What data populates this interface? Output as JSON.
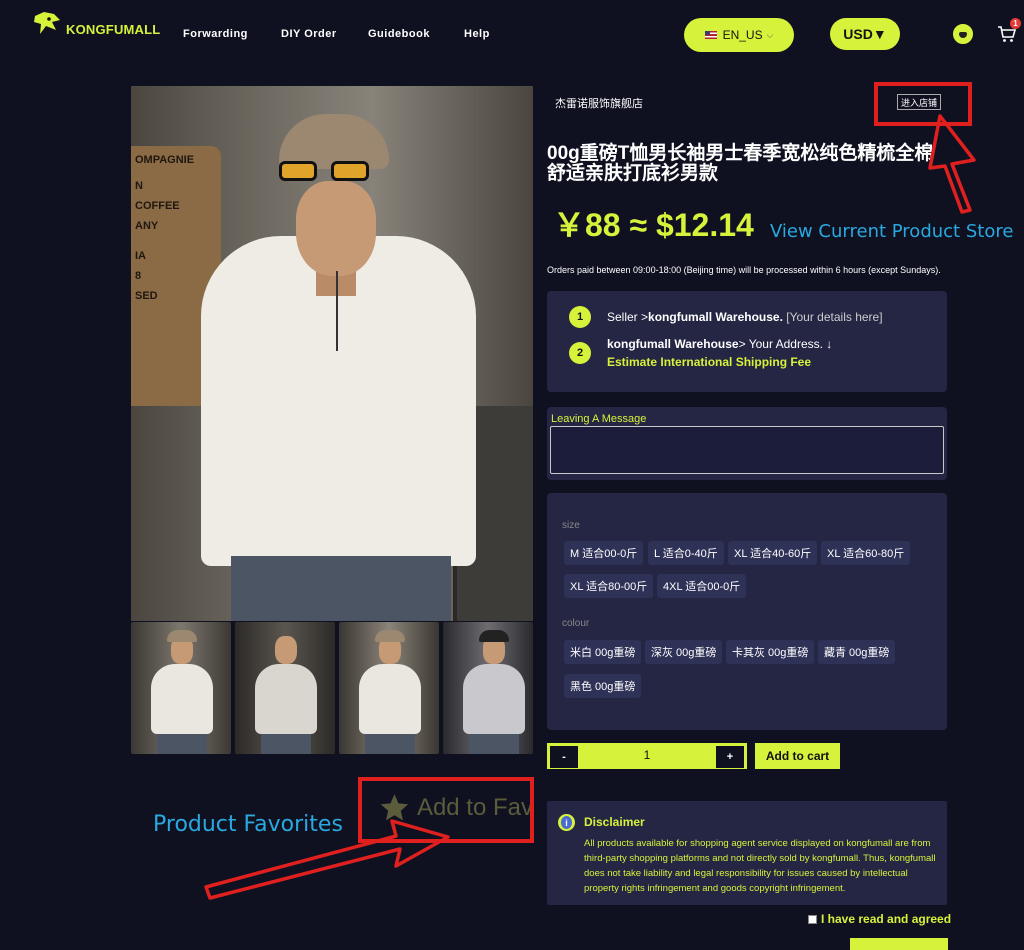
{
  "nav": {
    "brand": "KONGFUMALL",
    "links": [
      "Forwarding",
      "DIY Order",
      "Guidebook",
      "Help"
    ],
    "language": "EN_US",
    "currency": "USD▼",
    "cart_count": "1"
  },
  "product": {
    "shop_name": "杰雷诺服饰旗舰店",
    "store_button": "进入店铺",
    "title": "00g重磅T恤男长袖男士春季宽松纯色精梳全棉舒适亲肤打底衫男款",
    "price": "￥88 ≈ $12.14",
    "processing_note": "Orders paid between 09:00-18:00 (Beijing time) will be processed within 6 hours (except Sundays).",
    "photo_text": [
      "OMPAGNIE",
      "N",
      "COFFEE",
      "ANY",
      "IA",
      "8",
      "SED"
    ]
  },
  "shipping": {
    "step1_num": "1",
    "step1_prefix": "Seller >",
    "step1_bold": "kongfumall Warehouse.",
    "step1_suffix": " [Your details here]",
    "step2_num": "2",
    "step2_bold": "kongfumall Warehouse",
    "step2_suffix": "> Your Address. ↓",
    "estimate_link": "Estimate International Shipping Fee"
  },
  "message": {
    "label": "Leaving A Message",
    "value": ""
  },
  "options": {
    "size_title": "size",
    "sizes": [
      "M 适合00-0斤",
      "L 适合0-40斤",
      "XL 适合40-60斤",
      "XL 适合60-80斤",
      "XL 适合80-00斤",
      "4XL 适合00-0斤"
    ],
    "colour_title": "colour",
    "colours": [
      "米白 00g重磅",
      "深灰 00g重磅",
      "卡其灰 00g重磅",
      "藏青 00g重磅",
      "黑色 00g重磅"
    ]
  },
  "quantity": {
    "minus": "-",
    "value": "1",
    "plus": "+",
    "add_to_cart": "Add to cart"
  },
  "favorites": {
    "label": "Add to Fav"
  },
  "disclaimer": {
    "title": "Disclaimer",
    "body": "All products available for shopping agent service displayed on kongfumall are from third-party shopping platforms and not directly sold by kongfumall. Thus, kongfumall does not take liability and legal responsibility for issues caused by intellectual property rights infringement and goods copyright infringement.",
    "agree_label": "I have read and agreed"
  },
  "annotations": {
    "store_note": "View Current Product Store",
    "favorites_note": "Product Favorites"
  },
  "colors": {
    "accent": "#d7f23a",
    "background": "#0f1121",
    "card": "#242644",
    "annotation_red": "#e0201e",
    "annotation_blue": "#29a9e0"
  }
}
